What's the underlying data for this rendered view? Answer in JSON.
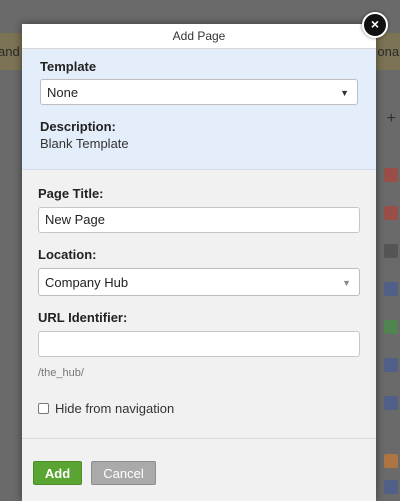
{
  "background": {
    "banner_left_text": "and",
    "banner_right_text": "onal",
    "side_icon_colors": [
      "#c0392b",
      "#c0392b",
      "#444",
      "#3a57a3",
      "#3a9b3a",
      "#3a57a3",
      "#3a57a3",
      "#e67e22",
      "#3a57a3"
    ],
    "plus_symbol": "+"
  },
  "modal": {
    "title": "Add Page",
    "close_symbol": "×",
    "template": {
      "label": "Template",
      "selected": "None",
      "caret": "▼"
    },
    "description": {
      "label": "Description:",
      "value": "Blank Template"
    },
    "page_title": {
      "label": "Page Title:",
      "value": "New Page"
    },
    "location": {
      "label": "Location:",
      "selected": "Company Hub",
      "caret": "▼"
    },
    "url_identifier": {
      "label": "URL Identifier:",
      "value": "",
      "hint": "/the_hub/"
    },
    "hide_from_navigation": {
      "label": "Hide from navigation",
      "checked": false
    },
    "buttons": {
      "add": "Add",
      "cancel": "Cancel"
    },
    "colors": {
      "template_bg": "#e4eefa",
      "add_button": "#5aa432",
      "cancel_button": "#aaaaaa"
    }
  }
}
